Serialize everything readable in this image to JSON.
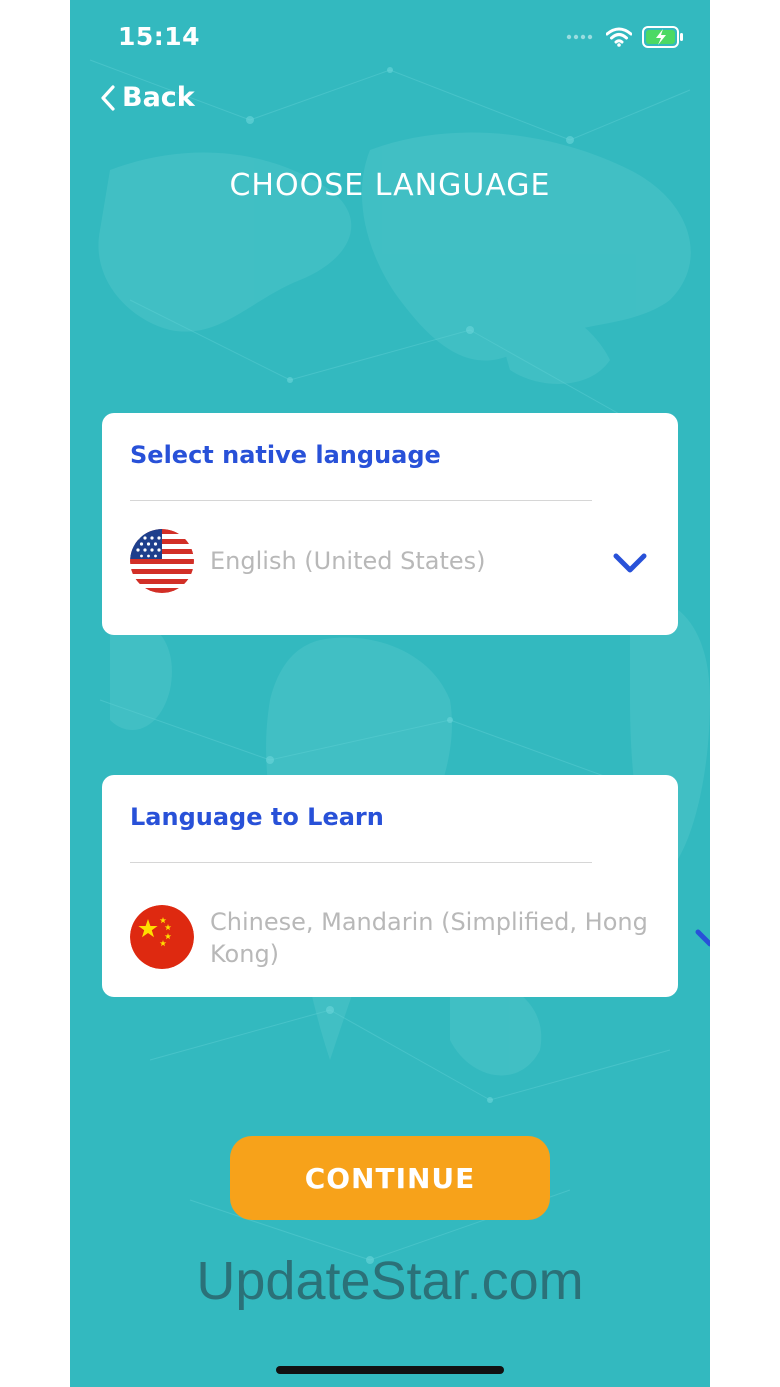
{
  "status_bar": {
    "time": "15:14",
    "icons": [
      "signal-dots-icon",
      "wifi-icon",
      "battery-charging-icon"
    ]
  },
  "nav": {
    "back_label": "Back",
    "back_icon": "chevron-left-icon"
  },
  "page": {
    "title": "CHOOSE LANGUAGE"
  },
  "native_language": {
    "heading": "Select native language",
    "value": "English (United States)",
    "flag_icon": "us-flag-icon",
    "dropdown_icon": "chevron-down-icon"
  },
  "learn_language": {
    "heading": "Language to Learn",
    "value": "Chinese, Mandarin (Simplified, Hong Kong)",
    "flag_icon": "china-flag-icon",
    "dropdown_icon": "chevron-down-icon"
  },
  "actions": {
    "continue_label": "CONTINUE"
  },
  "watermark": {
    "text": "UpdateStar.com"
  },
  "colors": {
    "background": "#33b9bf",
    "accent_blue": "#2851d8",
    "continue_orange": "#f7a21a",
    "placeholder_gray": "#b8b8b8"
  }
}
